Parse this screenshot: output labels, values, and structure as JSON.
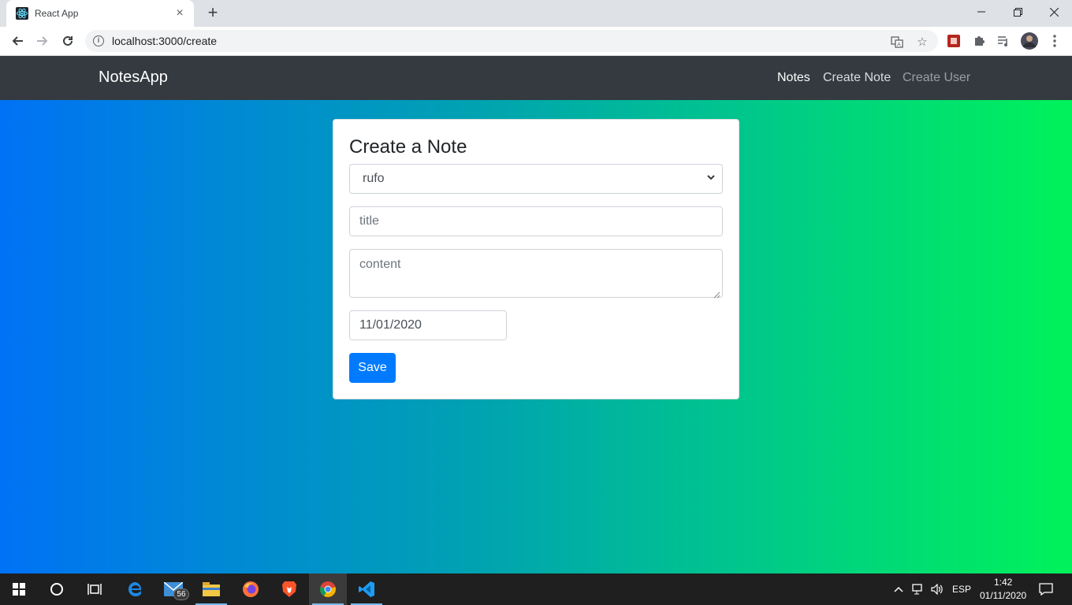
{
  "browser": {
    "tab_title": "React App",
    "url": "localhost:3000/create",
    "icons": [
      "react-favicon",
      "close-icon",
      "plus-icon",
      "minimize-icon",
      "restore-icon",
      "window-close-icon",
      "back-arrow-icon",
      "forward-arrow-icon",
      "reload-icon",
      "info-icon",
      "translate-icon",
      "star-icon",
      "extension-icon",
      "puzzle-icon",
      "media-queue-icon",
      "profile-avatar",
      "more-vert-icon"
    ]
  },
  "navbar": {
    "brand": "NotesApp",
    "links": [
      {
        "label": "Notes",
        "state": "active"
      },
      {
        "label": "Create Note",
        "state": "normal"
      },
      {
        "label": "Create User",
        "state": "muted"
      }
    ]
  },
  "form": {
    "heading": "Create a Note",
    "user_select": {
      "selected": "rufo"
    },
    "title_input": {
      "value": "",
      "placeholder": "title"
    },
    "content_input": {
      "value": "",
      "placeholder": "content"
    },
    "date_input": {
      "value": "11/01/2020"
    },
    "save_label": "Save"
  },
  "taskbar": {
    "apps": [
      "windows-start-icon",
      "cortana-search-icon",
      "task-view-icon",
      "edge-icon",
      "mail-icon",
      "file-explorer-icon",
      "firefox-icon",
      "brave-icon",
      "chrome-icon",
      "vscode-icon"
    ],
    "mail_badge": "56",
    "language": "ESP",
    "time": "1:42",
    "date": "01/11/2020"
  },
  "colors": {
    "navbar_bg": "#343a40",
    "gradient_start": "#0072f5",
    "gradient_end": "#00f25a",
    "primary_button": "#007bff",
    "tab_strip": "#dee1e6"
  }
}
